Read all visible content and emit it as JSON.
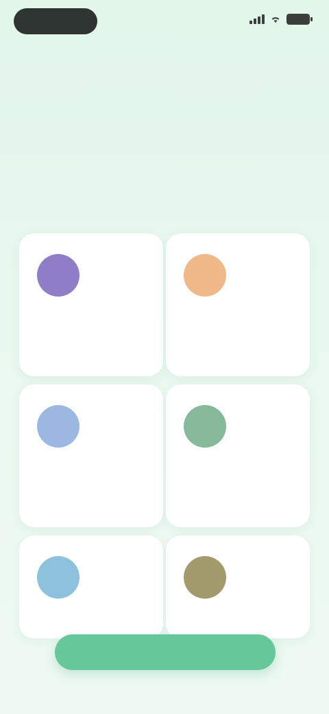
{
  "status_bar": {
    "time": "",
    "icons": [
      "signal-icon",
      "wifi-icon",
      "battery-icon"
    ]
  },
  "header": {
    "eyebrow": "",
    "headline": "",
    "subtitle": ""
  },
  "cards": [
    {
      "icon": "category-icon",
      "color": "#8f7dc8",
      "title": "",
      "value": ""
    },
    {
      "icon": "category-icon",
      "color": "#efb98a",
      "title": "",
      "value": ""
    },
    {
      "icon": "category-icon",
      "color": "#9db8e0",
      "title": "",
      "value": ""
    },
    {
      "icon": "category-icon",
      "color": "#86b99a",
      "title": "",
      "value": ""
    },
    {
      "icon": "category-icon",
      "color": "#8cc2dc",
      "title": "",
      "value": ""
    },
    {
      "icon": "category-icon",
      "color": "#a39a6e",
      "title": "",
      "value": ""
    }
  ],
  "cta": {
    "label": "",
    "color": "#66c79a"
  },
  "colors": {
    "background": "#e7f7ee",
    "accent": "#55b883"
  }
}
